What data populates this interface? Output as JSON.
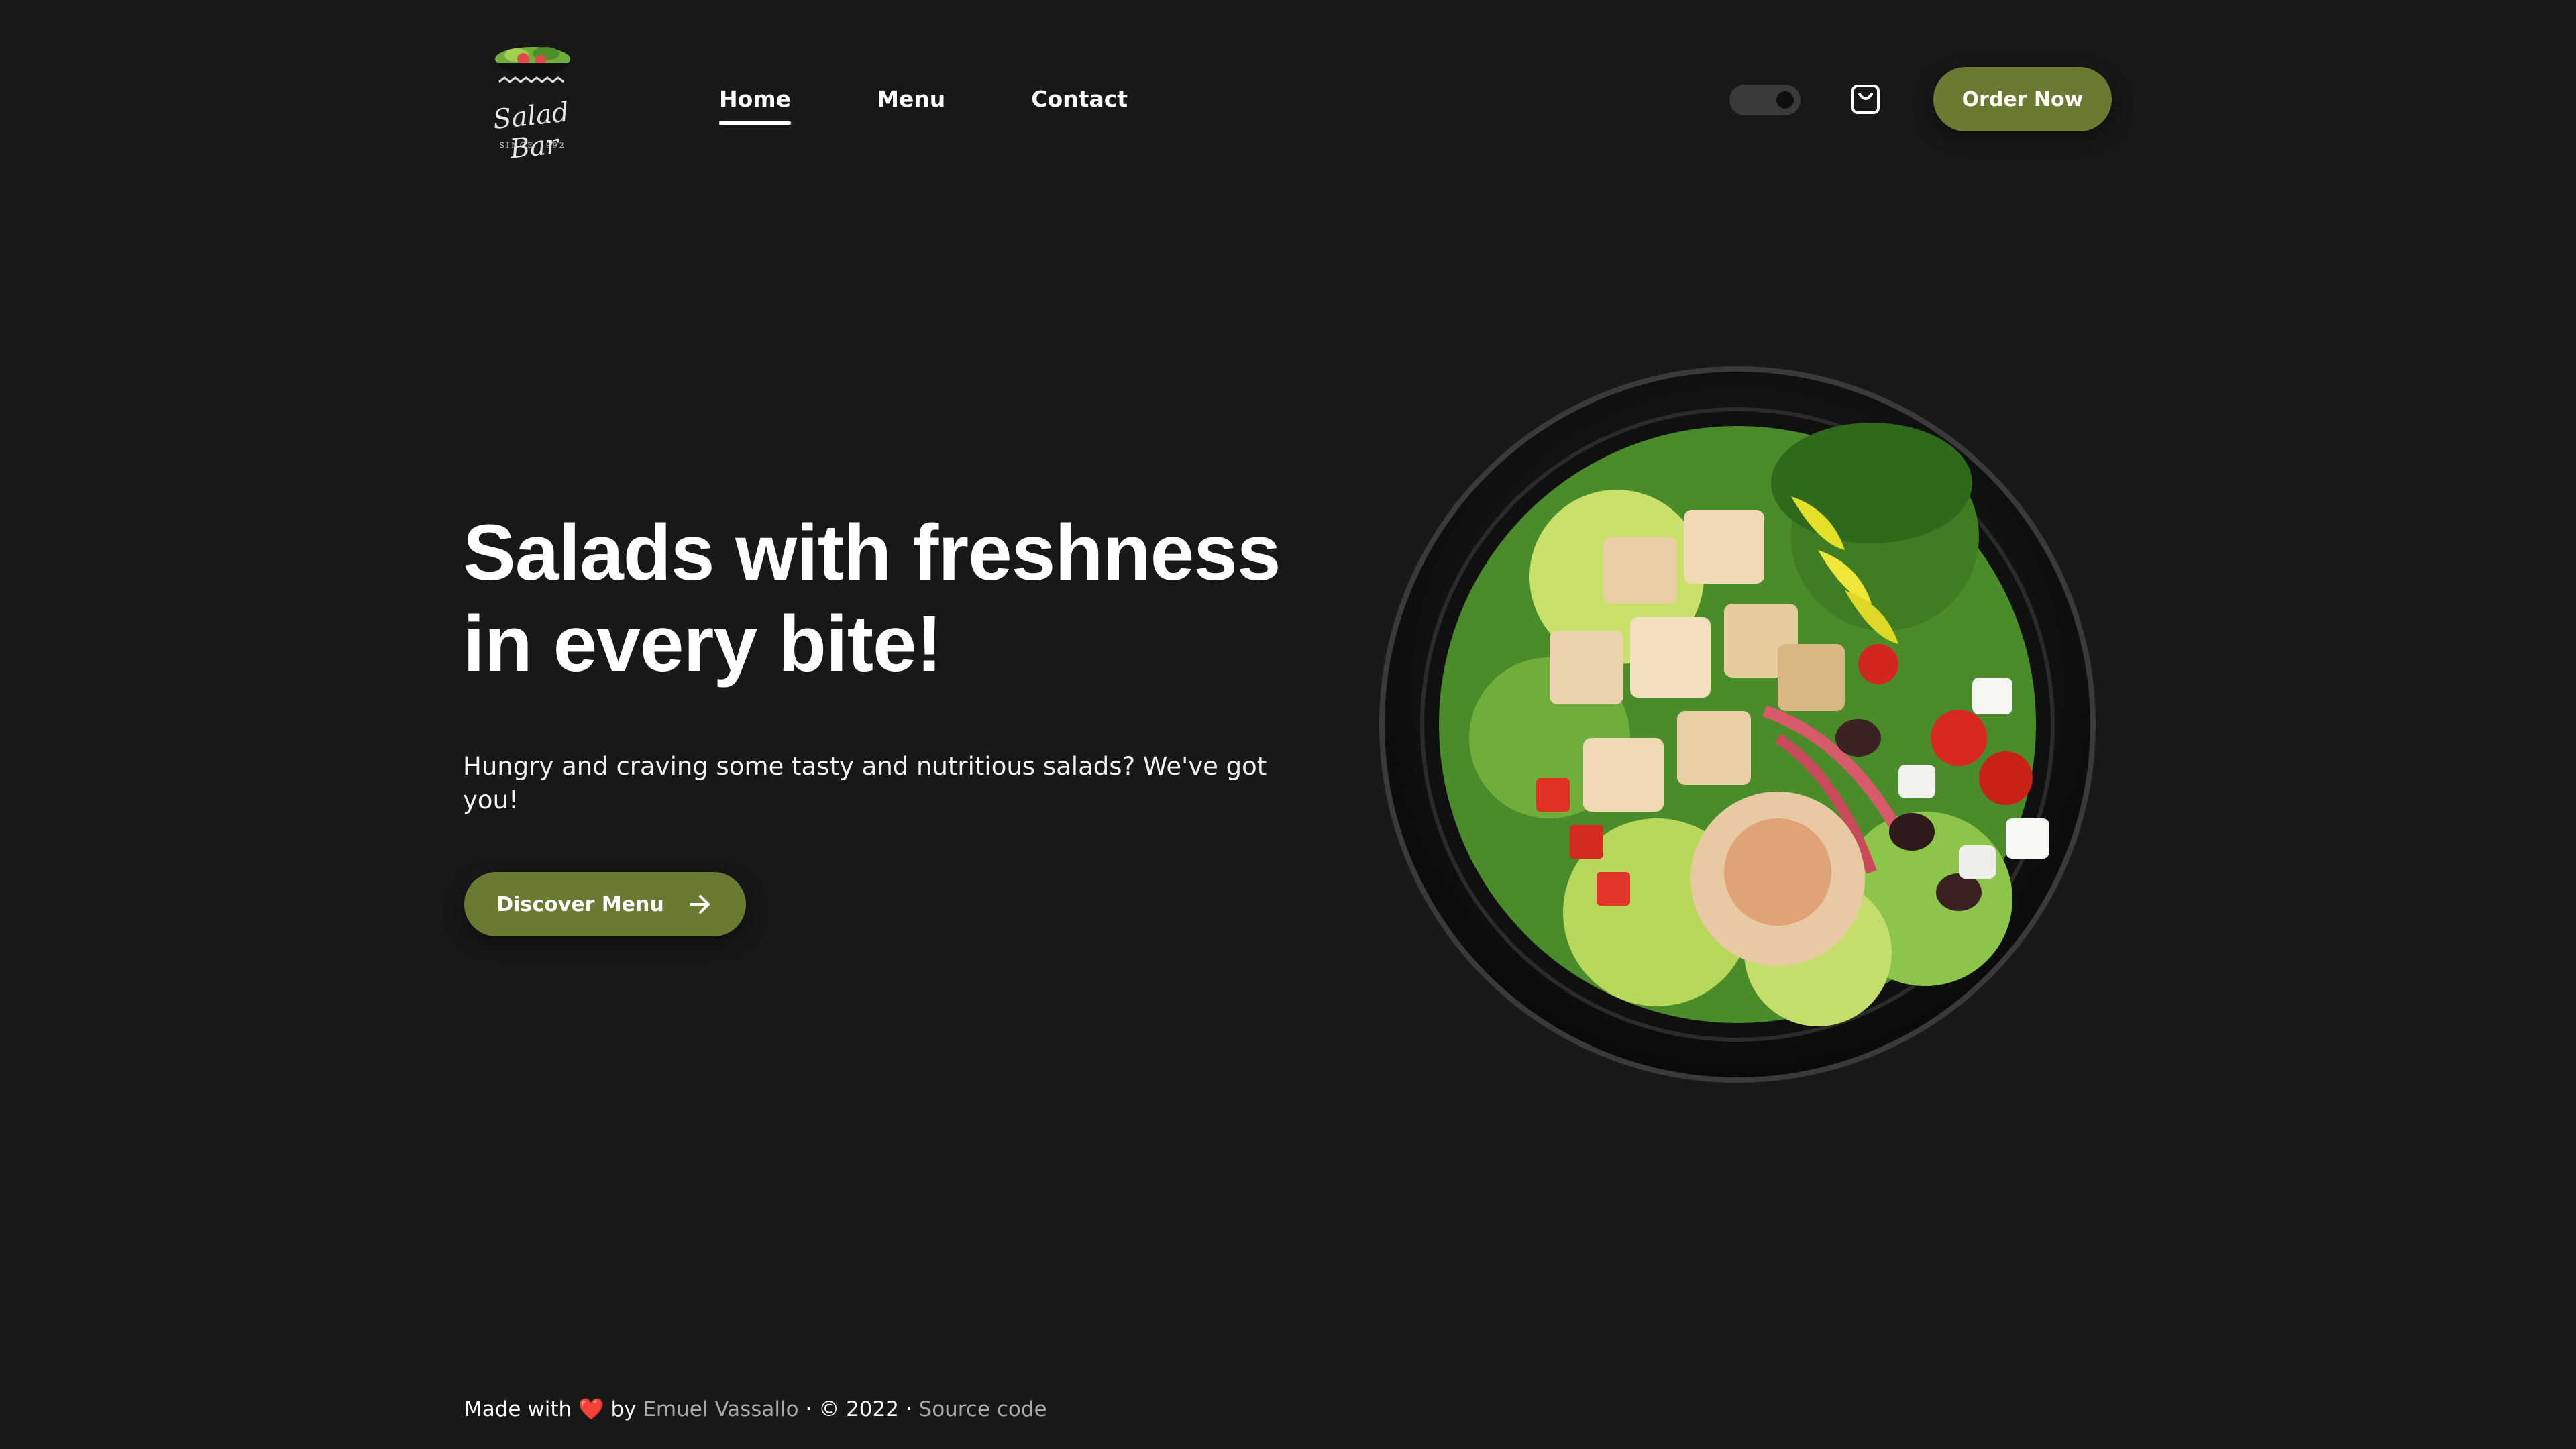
{
  "logo": {
    "script_text": "Salad Bar",
    "since_text": "SINCE 1992"
  },
  "nav": {
    "items": [
      {
        "label": "Home",
        "active": true
      },
      {
        "label": "Menu",
        "active": false
      },
      {
        "label": "Contact",
        "active": false
      }
    ]
  },
  "header": {
    "theme_toggle": {
      "state": "dark"
    },
    "cart_icon": "shopping-bag-icon",
    "order_button_label": "Order Now"
  },
  "hero": {
    "title_line1": "Salads with freshness",
    "title_line2": "in every bite!",
    "subtitle": "Hungry and craving some tasty and nutritious salads? We've got you!",
    "cta_label": "Discover Menu",
    "cta_icon": "arrow-right-icon",
    "image": "salad-bowl-image"
  },
  "footer": {
    "made_with": "Made with",
    "heart": "❤️",
    "by": "by",
    "author": "Emuel Vassallo",
    "separator1": "·",
    "copyright": "© 2022",
    "separator2": "·",
    "source_link": "Source code"
  },
  "colors": {
    "background": "#181818",
    "accent": "#6a7a33",
    "text": "#ffffff",
    "muted": "#a9a9a9"
  }
}
